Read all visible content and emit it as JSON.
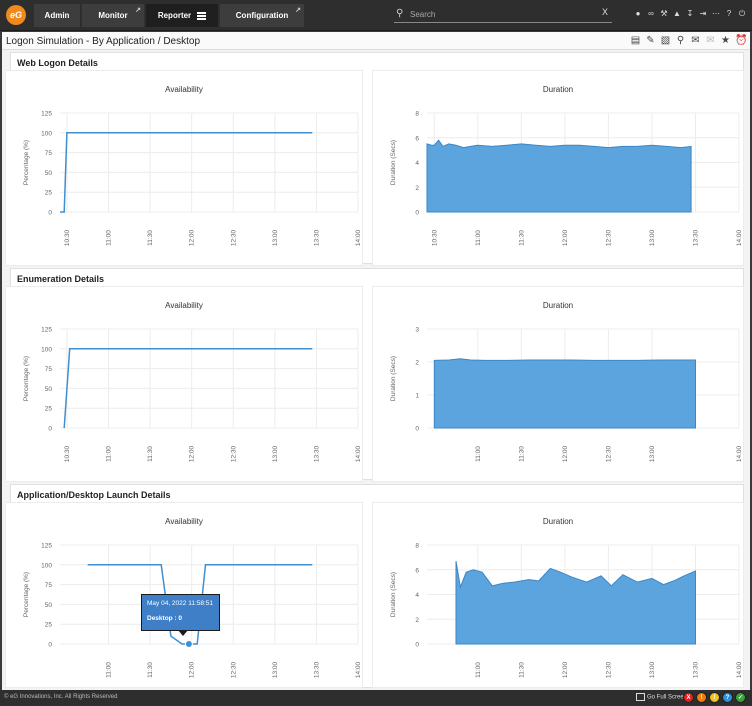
{
  "header": {
    "logo_text": "eG",
    "tabs": [
      {
        "label": "Admin"
      },
      {
        "label": "Monitor",
        "ext_icon": "external-link-icon"
      },
      {
        "label": "Reporter"
      },
      {
        "label": "Configuration",
        "ext_icon": "external-link-icon"
      }
    ],
    "search": {
      "placeholder": "Search",
      "value": "",
      "clear": "X"
    },
    "icons": [
      "user-icon",
      "link-icon",
      "tools-icon",
      "bell-icon",
      "download-icon",
      "logout-icon",
      "more-icon",
      "help-icon",
      "power-icon"
    ]
  },
  "page": {
    "title": "Logon Simulation - By Application / Desktop",
    "actions": [
      "report-icon",
      "edit-icon",
      "export-icon",
      "search-report-icon",
      "mail-icon",
      "disabled-mail-icon",
      "star-icon",
      "alarm-icon"
    ]
  },
  "sections": [
    {
      "title": "Web Logon Details"
    },
    {
      "title": "Enumeration Details"
    },
    {
      "title": "Application/Desktop Launch Details"
    }
  ],
  "chart_data": [
    {
      "section": "Web Logon Details",
      "title": "Availability",
      "type": "line",
      "ylabel": "Percentage (%)",
      "yticks": [
        0,
        25,
        50,
        75,
        100,
        125
      ],
      "ylim": [
        0,
        125
      ],
      "xticks": [
        "10:30",
        "11:00",
        "11:30",
        "12:00",
        "12:30",
        "13:00",
        "13:30",
        "14:00"
      ],
      "x": [
        "10:25",
        "10:28",
        "10:30",
        "10:35",
        "10:45",
        "11:00",
        "11:15",
        "11:30",
        "11:45",
        "12:00",
        "12:15",
        "12:30",
        "12:45",
        "13:00",
        "13:15",
        "13:27"
      ],
      "values": [
        0,
        0,
        100,
        100,
        100,
        100,
        100,
        100,
        100,
        100,
        100,
        100,
        100,
        100,
        100,
        100
      ],
      "color": "#3f8fd0",
      "grid": true
    },
    {
      "section": "Web Logon Details",
      "title": "Duration",
      "type": "area",
      "ylabel": "Duration (Secs)",
      "yticks": [
        0,
        2,
        4,
        6,
        8
      ],
      "ylim": [
        0,
        8
      ],
      "xticks": [
        "10:30",
        "11:00",
        "11:30",
        "12:00",
        "12:30",
        "13:00",
        "13:30",
        "14:00"
      ],
      "x": [
        "10:25",
        "10:28",
        "10:30",
        "10:33",
        "10:36",
        "10:40",
        "10:45",
        "10:50",
        "10:55",
        "11:00",
        "11:10",
        "11:20",
        "11:30",
        "11:40",
        "11:50",
        "12:00",
        "12:10",
        "12:20",
        "12:30",
        "12:40",
        "12:50",
        "13:00",
        "13:10",
        "13:20",
        "13:27"
      ],
      "values": [
        5.5,
        5.4,
        5.4,
        5.8,
        5.3,
        5.5,
        5.4,
        5.2,
        5.3,
        5.4,
        5.3,
        5.4,
        5.5,
        5.4,
        5.3,
        5.4,
        5.4,
        5.3,
        5.2,
        5.3,
        5.3,
        5.4,
        5.3,
        5.2,
        5.3
      ],
      "color": "#5ba4de",
      "grid": true
    },
    {
      "section": "Enumeration Details",
      "title": "Availability",
      "type": "line",
      "ylabel": "Percentage (%)",
      "yticks": [
        0,
        25,
        50,
        75,
        100,
        125
      ],
      "ylim": [
        0,
        125
      ],
      "xticks": [
        "10:30",
        "11:00",
        "11:30",
        "12:00",
        "12:30",
        "13:00",
        "13:30",
        "14:00"
      ],
      "x": [
        "10:28",
        "10:32",
        "10:45",
        "11:00",
        "11:30",
        "12:00",
        "12:30",
        "13:00",
        "13:27"
      ],
      "values": [
        0,
        100,
        100,
        100,
        100,
        100,
        100,
        100,
        100
      ],
      "color": "#3f8fd0",
      "grid": true
    },
    {
      "section": "Enumeration Details",
      "title": "Duration",
      "type": "area",
      "ylabel": "Duration (Secs)",
      "yticks": [
        0,
        1,
        2,
        3
      ],
      "ylim": [
        0,
        3
      ],
      "xticks": [
        "11:00",
        "11:30",
        "12:00",
        "12:30",
        "13:00",
        "14:00"
      ],
      "x": [
        "10:30",
        "10:40",
        "10:48",
        "10:55",
        "11:05",
        "11:20",
        "11:35",
        "11:50",
        "12:05",
        "12:20",
        "12:35",
        "12:50",
        "13:05",
        "13:20",
        "13:30"
      ],
      "values": [
        2.05,
        2.06,
        2.1,
        2.06,
        2.05,
        2.05,
        2.06,
        2.06,
        2.06,
        2.05,
        2.05,
        2.05,
        2.06,
        2.06,
        2.06
      ],
      "color": "#5ba4de",
      "grid": true
    },
    {
      "section": "Application/Desktop Launch Details",
      "title": "Availability",
      "type": "line",
      "ylabel": "Percentage (%)",
      "yticks": [
        0,
        25,
        50,
        75,
        100,
        125
      ],
      "ylim": [
        0,
        125
      ],
      "xticks": [
        "11:00",
        "11:30",
        "12:00",
        "12:30",
        "13:00",
        "13:30",
        "14:00"
      ],
      "x": [
        "10:45",
        "11:00",
        "11:15",
        "11:30",
        "11:38",
        "11:45",
        "11:53",
        "11:58",
        "12:04",
        "12:10",
        "12:30",
        "13:00",
        "13:27"
      ],
      "values": [
        100,
        100,
        100,
        100,
        100,
        10,
        0,
        0,
        0,
        100,
        100,
        100,
        100
      ],
      "color": "#3f8fd0",
      "grid": true,
      "highlight": {
        "x": "11:58",
        "value": 0
      },
      "tooltip": {
        "date": "May 04, 2022 11:58:51",
        "label": "Desktop : 0"
      }
    },
    {
      "section": "Application/Desktop Launch Details",
      "title": "Duration",
      "type": "area",
      "ylabel": "Duration (Secs)",
      "yticks": [
        0,
        2,
        4,
        6,
        8
      ],
      "ylim": [
        0,
        8
      ],
      "xticks": [
        "11:00",
        "11:30",
        "12:00",
        "12:30",
        "13:00",
        "13:30",
        "14:00"
      ],
      "x": [
        "10:45",
        "10:48",
        "10:52",
        "10:57",
        "11:03",
        "11:10",
        "11:17",
        "11:25",
        "11:35",
        "11:42",
        "11:50",
        "11:57",
        "12:05",
        "12:15",
        "12:25",
        "12:32",
        "12:40",
        "12:50",
        "13:00",
        "13:08",
        "13:15",
        "13:22",
        "13:30"
      ],
      "values": [
        6.7,
        4.6,
        5.8,
        6.0,
        5.8,
        4.7,
        4.9,
        5.0,
        5.2,
        5.1,
        6.1,
        5.8,
        5.4,
        5.0,
        5.5,
        4.7,
        5.6,
        5.0,
        5.3,
        4.8,
        5.1,
        5.5,
        5.9
      ],
      "color": "#5ba4de",
      "grid": true
    }
  ],
  "footer": {
    "copyright": "© eG Innovations, Inc. All Rights Reserved",
    "fullscreen": "Go Full Screen",
    "badges": [
      {
        "label": "X",
        "color": "#e02020"
      },
      {
        "label": "!",
        "color": "#f07d12"
      },
      {
        "label": "!",
        "color": "#f2c31a"
      },
      {
        "label": "?",
        "color": "#2f8fd8"
      },
      {
        "label": "✓",
        "color": "#3aa23a"
      }
    ]
  }
}
